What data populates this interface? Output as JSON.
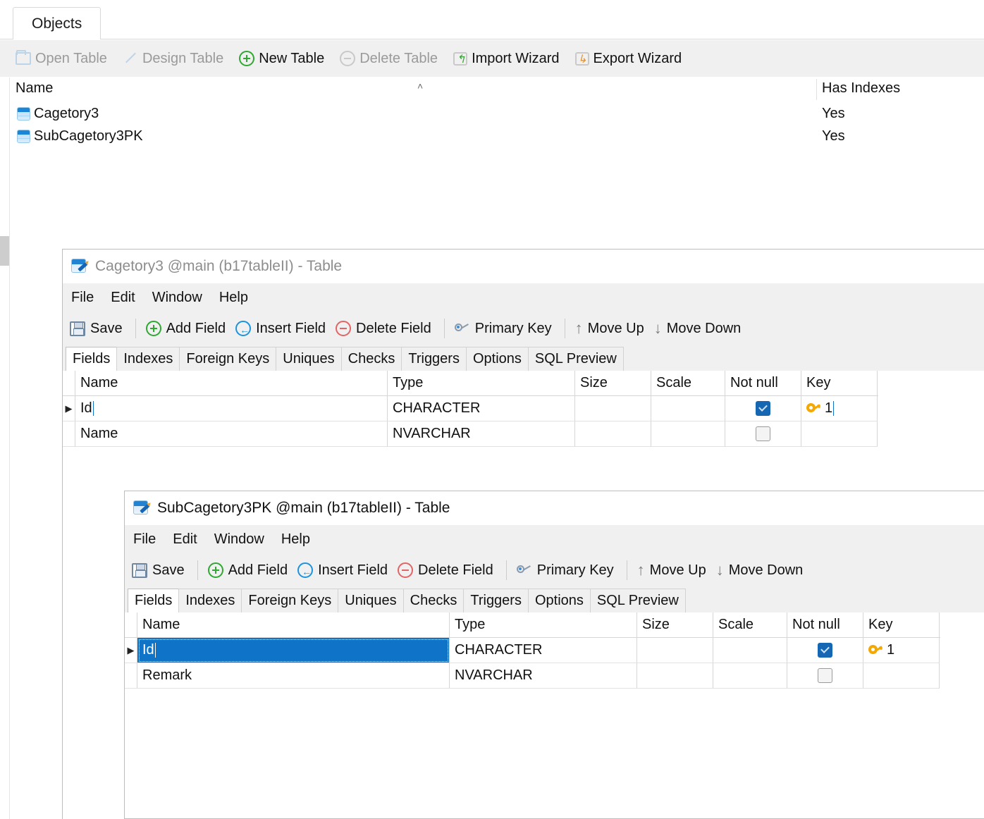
{
  "main_tab": {
    "label": "Objects"
  },
  "toolbar": {
    "items": [
      {
        "label": "Open Table",
        "icon": "folder-icon",
        "enabled": false
      },
      {
        "label": "Design Table",
        "icon": "pencil-icon",
        "enabled": false
      },
      {
        "label": "New Table",
        "icon": "circle-plus-icon",
        "enabled": true
      },
      {
        "label": "Delete Table",
        "icon": "circle-minus-icon",
        "enabled": false
      },
      {
        "label": "Import Wizard",
        "icon": "import-arrow-icon",
        "enabled": true
      },
      {
        "label": "Export Wizard",
        "icon": "export-arrow-icon",
        "enabled": true
      }
    ]
  },
  "object_list": {
    "columns": [
      "Name",
      "Has Indexes"
    ],
    "sort_indicator": "˄",
    "rows": [
      {
        "name": "Cagetory3",
        "has_indexes": "Yes"
      },
      {
        "name": "SubCagetory3PK",
        "has_indexes": "Yes"
      }
    ]
  },
  "windows": [
    {
      "title": "Cagetory3 @main (b17tableII) - Table",
      "active": false,
      "menu": [
        "File",
        "Edit",
        "Window",
        "Help"
      ],
      "toolbar": [
        {
          "label": "Save",
          "icon": "save-icon"
        },
        {
          "label": "Add Field",
          "icon": "circle-plus-icon"
        },
        {
          "label": "Insert Field",
          "icon": "circle-left-arrow-icon"
        },
        {
          "label": "Delete Field",
          "icon": "circle-minus-icon"
        },
        {
          "label": "Primary Key",
          "icon": "key-icon"
        },
        {
          "label": "Move Up",
          "icon": "arrow-up-icon"
        },
        {
          "label": "Move Down",
          "icon": "arrow-down-icon"
        }
      ],
      "tabs": [
        "Fields",
        "Indexes",
        "Foreign Keys",
        "Uniques",
        "Checks",
        "Triggers",
        "Options",
        "SQL Preview"
      ],
      "selected_tab": "Fields",
      "grid": {
        "columns": [
          "Name",
          "Type",
          "Size",
          "Scale",
          "Not null",
          "Key"
        ],
        "rows": [
          {
            "indicator": "▶",
            "name": "Id",
            "type": "CHARACTER",
            "size": "",
            "scale": "",
            "not_null": true,
            "key": "1",
            "selected": false,
            "focused": true
          },
          {
            "indicator": "",
            "name": "Name",
            "type": "NVARCHAR",
            "size": "",
            "scale": "",
            "not_null": false,
            "key": "",
            "selected": false,
            "focused": false
          }
        ]
      }
    },
    {
      "title": "SubCagetory3PK @main (b17tableII) - Table",
      "active": true,
      "menu": [
        "File",
        "Edit",
        "Window",
        "Help"
      ],
      "toolbar": [
        {
          "label": "Save",
          "icon": "save-icon"
        },
        {
          "label": "Add Field",
          "icon": "circle-plus-icon"
        },
        {
          "label": "Insert Field",
          "icon": "circle-left-arrow-icon"
        },
        {
          "label": "Delete Field",
          "icon": "circle-minus-icon"
        },
        {
          "label": "Primary Key",
          "icon": "key-icon"
        },
        {
          "label": "Move Up",
          "icon": "arrow-up-icon"
        },
        {
          "label": "Move Down",
          "icon": "arrow-down-icon"
        }
      ],
      "tabs": [
        "Fields",
        "Indexes",
        "Foreign Keys",
        "Uniques",
        "Checks",
        "Triggers",
        "Options",
        "SQL Preview"
      ],
      "selected_tab": "Fields",
      "grid": {
        "columns": [
          "Name",
          "Type",
          "Size",
          "Scale",
          "Not null",
          "Key"
        ],
        "rows": [
          {
            "indicator": "▶",
            "name": "Id",
            "type": "CHARACTER",
            "size": "",
            "scale": "",
            "not_null": true,
            "key": "1",
            "selected": true,
            "focused": true
          },
          {
            "indicator": "",
            "name": "Remark",
            "type": "NVARCHAR",
            "size": "",
            "scale": "",
            "not_null": false,
            "key": "",
            "selected": false,
            "focused": false
          }
        ]
      }
    }
  ],
  "colors": {
    "selection_blue": "#0f74c8",
    "checkbox_blue": "#1567b3",
    "key_gold": "#f5a800",
    "toolbar_bg": "#f0f0f0",
    "disabled_text": "#9a9a9a"
  }
}
